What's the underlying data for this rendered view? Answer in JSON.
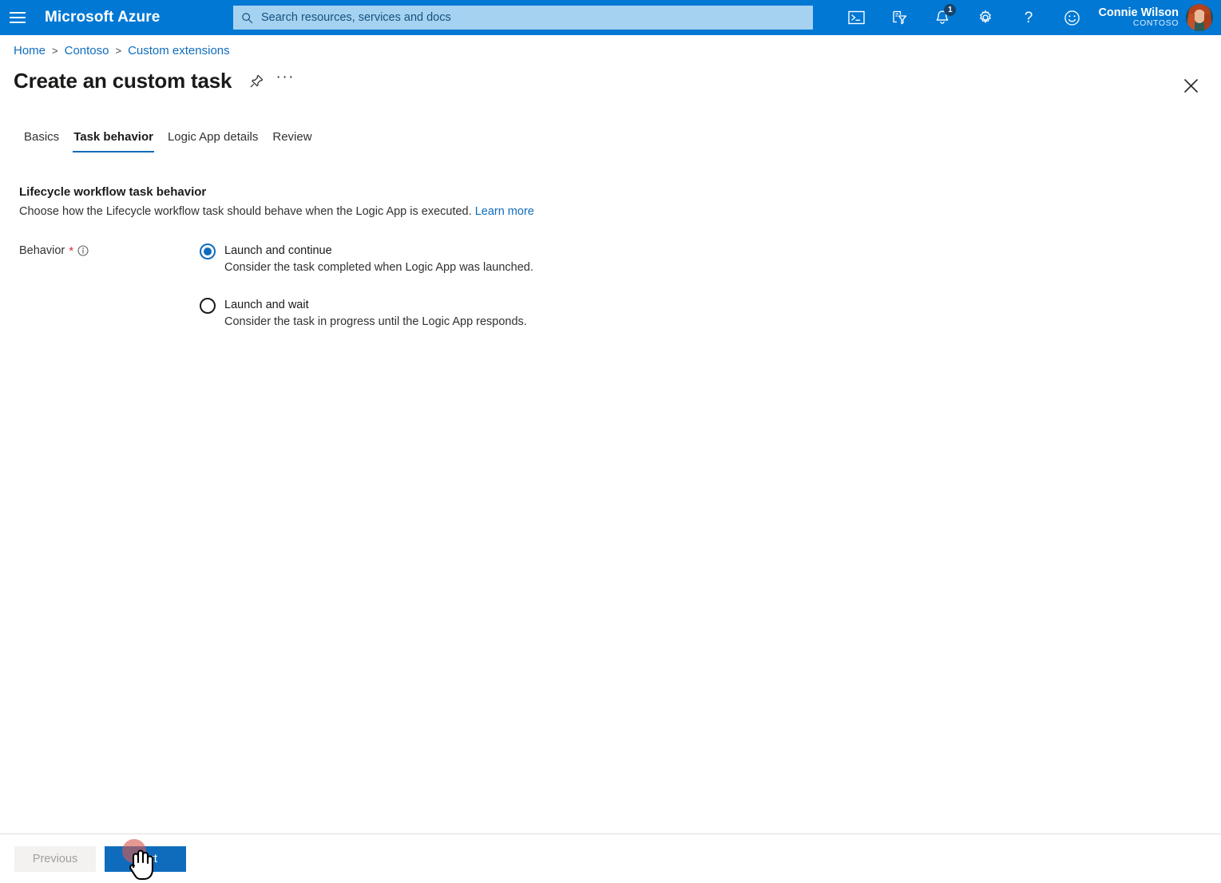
{
  "header": {
    "menu_icon": "hamburger-menu-icon",
    "brand": "Microsoft Azure",
    "search": {
      "placeholder": "Search resources, services and docs",
      "value": "",
      "icon": "search-icon"
    },
    "icons": [
      {
        "name": "cloud-shell-icon",
        "title": "Cloud Shell"
      },
      {
        "name": "directory-filter-icon",
        "title": "Directories + subscriptions"
      },
      {
        "name": "notifications-bell-icon",
        "title": "Notifications",
        "badge": "1"
      },
      {
        "name": "settings-gear-icon",
        "title": "Settings"
      },
      {
        "name": "help-question-icon",
        "title": "Help"
      },
      {
        "name": "feedback-smiley-icon",
        "title": "Feedback"
      }
    ],
    "user": {
      "name": "Connie Wilson",
      "tenant": "CONTOSO",
      "avatar": "user-avatar"
    }
  },
  "breadcrumb": {
    "items": [
      {
        "label": "Home"
      },
      {
        "label": "Contoso"
      },
      {
        "label": "Custom extensions"
      }
    ],
    "separator": ">"
  },
  "blade": {
    "title": "Create an custom task",
    "pin_icon": "pin-icon",
    "more_icon": "ellipsis-icon",
    "more_label": "···",
    "close_icon": "close-icon"
  },
  "tabs": [
    {
      "label": "Basics",
      "active": false
    },
    {
      "label": "Task behavior",
      "active": true
    },
    {
      "label": "Logic App details",
      "active": false
    },
    {
      "label": "Review",
      "active": false
    }
  ],
  "section": {
    "title": "Lifecycle workflow task behavior",
    "description": "Choose how the Lifecycle workflow task should behave when the Logic App is executed.",
    "learn_more": "Learn more"
  },
  "form": {
    "behavior": {
      "label": "Behavior",
      "required_marker": "*",
      "info_icon": "info-icon",
      "options": [
        {
          "title": "Launch and continue",
          "description": "Consider the task completed when Logic App was launched.",
          "selected": true
        },
        {
          "title": "Launch and wait",
          "description": "Consider the task in progress until the Logic App responds.",
          "selected": false
        }
      ]
    }
  },
  "footer": {
    "previous_label": "Previous",
    "previous_disabled": true,
    "next_label": "Next"
  },
  "colors": {
    "azure_blue": "#0078d4",
    "accent": "#0f6cbd",
    "link": "#0f6cbd",
    "required_red": "#d13438",
    "disabled_text": "#a19f9d"
  },
  "cursor": {
    "pointer_icon": "hand-pointer-cursor",
    "click_indicator": "click-ripple"
  }
}
